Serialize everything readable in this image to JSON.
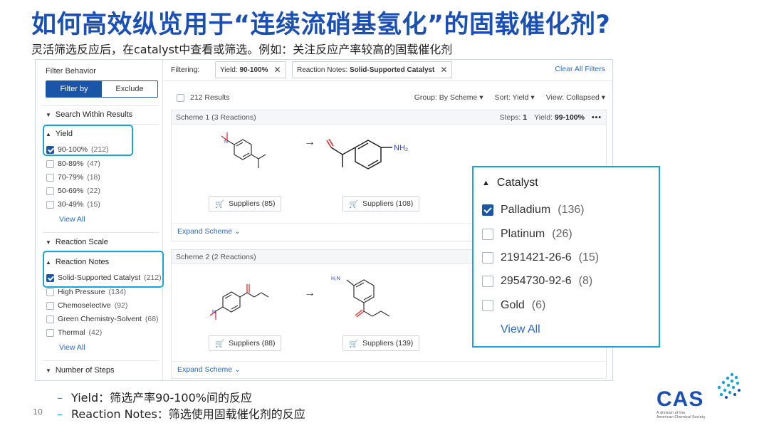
{
  "slide": {
    "title": "如何高效纵览用于“连续流硝基氢化”的固载催化剂?",
    "subtitle": "灵活筛选反应后，在catalyst中查看或筛选。例如：关注反应产率较高的固载催化剂",
    "bullets": [
      "Yield：筛选产率90-100%间的反应",
      "Reaction Notes：筛选使用固载催化剂的反应"
    ],
    "page_number": "10"
  },
  "sidebar": {
    "title": "Filter Behavior",
    "toggle": {
      "filter_by": "Filter by",
      "exclude": "Exclude"
    },
    "search_within": "Search Within Results",
    "yield": {
      "header": "Yield",
      "options": [
        {
          "label": "90-100%",
          "count": "(212)",
          "checked": true
        },
        {
          "label": "80-89%",
          "count": "(47)",
          "checked": false
        },
        {
          "label": "70-79%",
          "count": "(18)",
          "checked": false
        },
        {
          "label": "50-69%",
          "count": "(22)",
          "checked": false
        },
        {
          "label": "30-49%",
          "count": "(15)",
          "checked": false
        }
      ],
      "view_all": "View All"
    },
    "reaction_scale": "Reaction Scale",
    "reaction_notes": {
      "header": "Reaction Notes",
      "options": [
        {
          "label": "Solid-Supported Catalyst",
          "count": "(212)",
          "checked": true
        },
        {
          "label": "High Pressure",
          "count": "(134)",
          "checked": false
        },
        {
          "label": "Chemoselective",
          "count": "(92)",
          "checked": false
        },
        {
          "label": "Green Chemistry-Solvent",
          "count": "(68)",
          "checked": false
        },
        {
          "label": "Thermal",
          "count": "(42)",
          "checked": false
        }
      ],
      "view_all": "View All"
    },
    "number_of_steps": "Number of Steps"
  },
  "topbar": {
    "filtering_label": "Filtering:",
    "chips": [
      {
        "key": "Yield:",
        "value": "90-100%"
      },
      {
        "key": "Reaction Notes:",
        "value": "Solid-Supported Catalyst"
      }
    ],
    "clear_all": "Clear All Filters"
  },
  "results": {
    "count": "212 Results",
    "group": "Group:  By Scheme",
    "sort": "Sort:  Yield",
    "view": "View:  Collapsed"
  },
  "schemes": [
    {
      "title": "Scheme 1  (3 Reactions)",
      "steps_label": "Steps:",
      "steps": "1",
      "yield_label": "Yield:",
      "yield": "99-100%",
      "suppliers_left": "Suppliers (85)",
      "suppliers_right": "Suppliers (108)",
      "expand": "Expand Scheme"
    },
    {
      "title": "Scheme 2  (2 Reactions)",
      "suppliers_left": "Suppliers (88)",
      "suppliers_right": "Suppliers (139)",
      "expand": "Expand Scheme"
    }
  ],
  "molecules": {
    "nh2": "NH₂",
    "h2n": "H₂N",
    "nitro_label": "N"
  },
  "catalyst_panel": {
    "header": "Catalyst",
    "options": [
      {
        "label": "Palladium",
        "count": "(136)",
        "checked": true
      },
      {
        "label": "Platinum",
        "count": "(26)",
        "checked": false
      },
      {
        "label": "2191421-26-6",
        "count": "(15)",
        "checked": false
      },
      {
        "label": "2954730-92-6",
        "count": "(8)",
        "checked": false
      },
      {
        "label": "Gold",
        "count": "(6)",
        "checked": false
      }
    ],
    "view_all": "View All"
  },
  "logo": {
    "text": "CAS",
    "tagline_1": "A division of the",
    "tagline_2": "American Chemical Society"
  },
  "colors": {
    "title_blue": "#1a4fb3",
    "highlight_cyan": "#1aa3d9",
    "primary_button": "#1a55a8",
    "link_blue": "#2a6bc4"
  }
}
